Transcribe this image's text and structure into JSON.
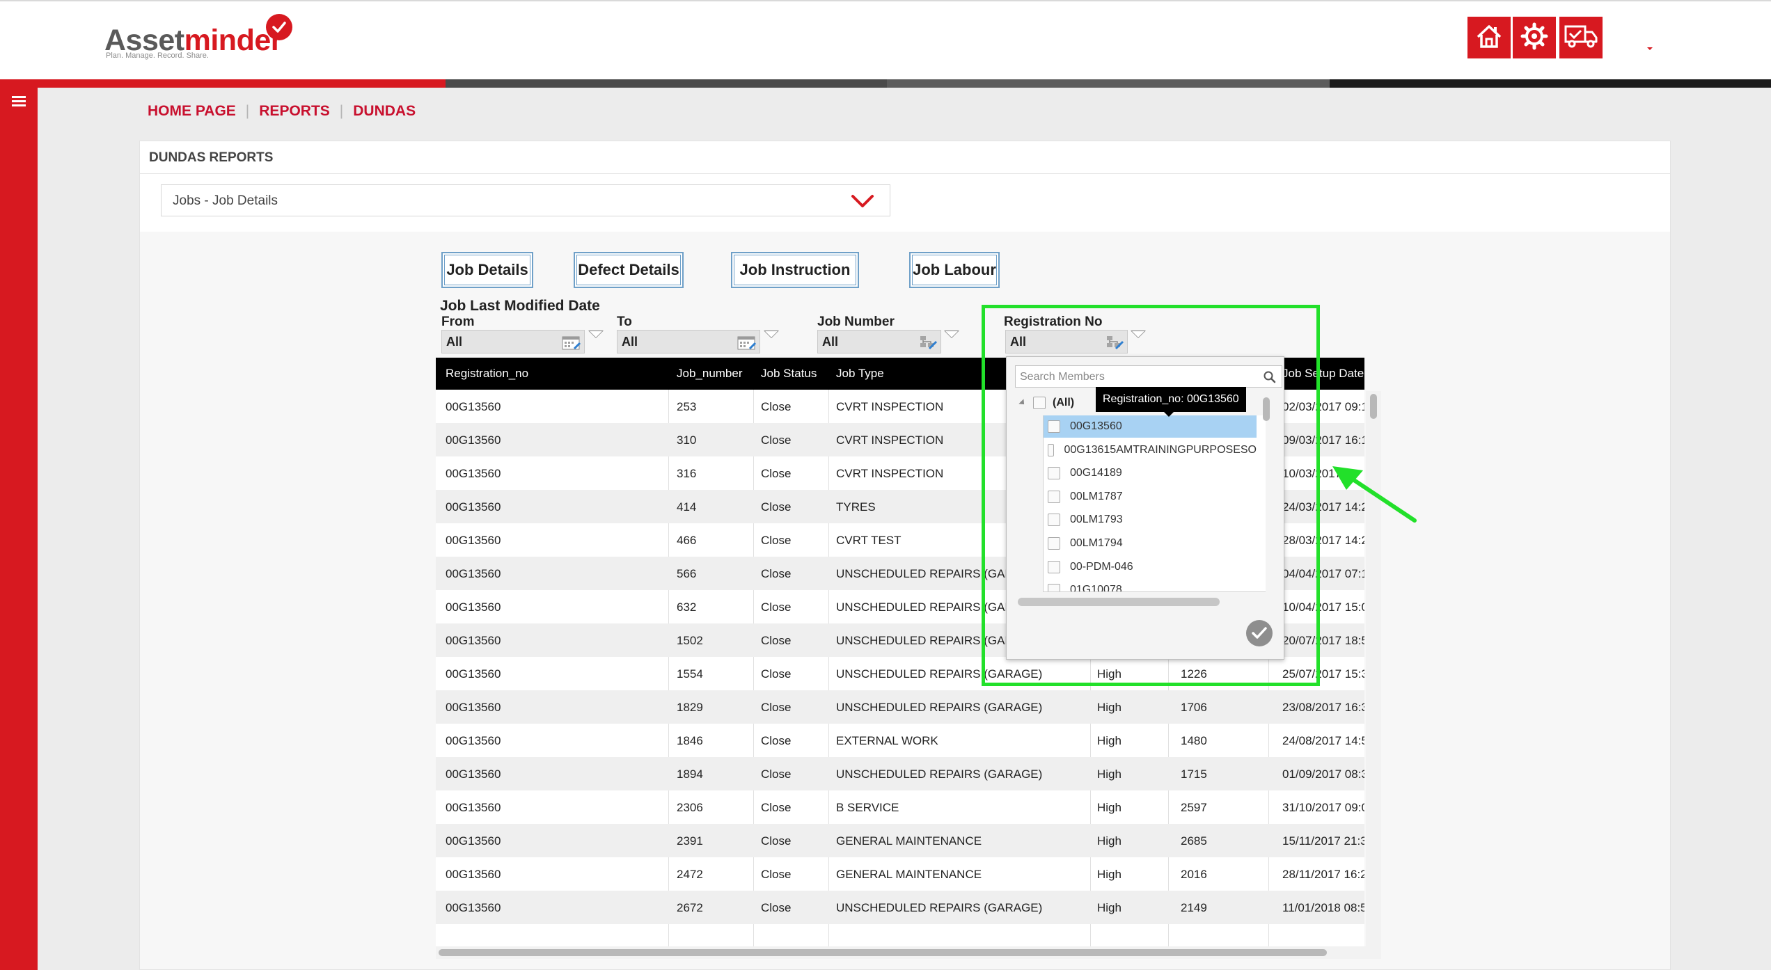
{
  "header": {
    "logo": {
      "word_part1": "Asset",
      "word_part2": "minder",
      "tagline": "Plan. Manage. Record. Share."
    },
    "buttons": [
      {
        "icon": "home-icon"
      },
      {
        "icon": "settings-gear-icon"
      },
      {
        "icon": "truck-icon"
      }
    ],
    "colors": {
      "brand_red": "#d71920",
      "progress_dark": "#4a4a4a",
      "progress_black": "#1c1c1c"
    }
  },
  "breadcrumb": {
    "items": [
      "HOME PAGE",
      "REPORTS",
      "DUNDAS"
    ],
    "separator": "|"
  },
  "panel": {
    "title": "DUNDAS REPORTS",
    "report_select": {
      "value": "Jobs - Job Details"
    }
  },
  "report": {
    "tabs": [
      "Job Details",
      "Defect Details",
      "Job Instruction",
      "Job Labour"
    ],
    "filters": {
      "group_label": "Job Last Modified Date",
      "from": {
        "label": "From",
        "value": "All"
      },
      "to": {
        "label": "To",
        "value": "All"
      },
      "job_number": {
        "label": "Job Number",
        "value": "All"
      },
      "registration_no": {
        "label": "Registration No",
        "value": "All"
      }
    },
    "table": {
      "columns": [
        "Registration_no",
        "Job_number",
        "Job Status",
        "Job Type",
        "Job Setup Date"
      ],
      "rows": [
        {
          "reg": "00G13560",
          "num": "253",
          "status": "Close",
          "type": "CVRT INSPECTION",
          "priority": "",
          "ref": "",
          "date": "02/03/2017 09:1"
        },
        {
          "reg": "00G13560",
          "num": "310",
          "status": "Close",
          "type": "CVRT INSPECTION",
          "priority": "",
          "ref": "",
          "date": "09/03/2017 16:1"
        },
        {
          "reg": "00G13560",
          "num": "316",
          "status": "Close",
          "type": "CVRT INSPECTION",
          "priority": "",
          "ref": "",
          "date": "10/03/2017"
        },
        {
          "reg": "00G13560",
          "num": "414",
          "status": "Close",
          "type": "TYRES",
          "priority": "",
          "ref": "",
          "date": "24/03/2017 14:2"
        },
        {
          "reg": "00G13560",
          "num": "466",
          "status": "Close",
          "type": "CVRT TEST",
          "priority": "",
          "ref": "",
          "date": "28/03/2017 14:2"
        },
        {
          "reg": "00G13560",
          "num": "566",
          "status": "Close",
          "type": "UNSCHEDULED REPAIRS (GARA",
          "priority": "",
          "ref": "",
          "date": "04/04/2017 07:1"
        },
        {
          "reg": "00G13560",
          "num": "632",
          "status": "Close",
          "type": "UNSCHEDULED REPAIRS (GARA",
          "priority": "",
          "ref": "",
          "date": "10/04/2017 15:0"
        },
        {
          "reg": "00G13560",
          "num": "1502",
          "status": "Close",
          "type": "UNSCHEDULED REPAIRS (GARA",
          "priority": "",
          "ref": "",
          "date": "20/07/2017 18:5"
        },
        {
          "reg": "00G13560",
          "num": "1554",
          "status": "Close",
          "type": "UNSCHEDULED REPAIRS (GARAGE)",
          "priority": "High",
          "ref": "1226",
          "date": "25/07/2017 15:3"
        },
        {
          "reg": "00G13560",
          "num": "1829",
          "status": "Close",
          "type": "UNSCHEDULED REPAIRS (GARAGE)",
          "priority": "High",
          "ref": "1706",
          "date": "23/08/2017 16:3"
        },
        {
          "reg": "00G13560",
          "num": "1846",
          "status": "Close",
          "type": "EXTERNAL WORK",
          "priority": "High",
          "ref": "1480",
          "date": "24/08/2017 14:5"
        },
        {
          "reg": "00G13560",
          "num": "1894",
          "status": "Close",
          "type": "UNSCHEDULED REPAIRS (GARAGE)",
          "priority": "High",
          "ref": "1715",
          "date": "01/09/2017 08:3"
        },
        {
          "reg": "00G13560",
          "num": "2306",
          "status": "Close",
          "type": "B SERVICE",
          "priority": "High",
          "ref": "2597",
          "date": "31/10/2017 09:0"
        },
        {
          "reg": "00G13560",
          "num": "2391",
          "status": "Close",
          "type": "GENERAL MAINTENANCE",
          "priority": "High",
          "ref": "2685",
          "date": "15/11/2017 21:3"
        },
        {
          "reg": "00G13560",
          "num": "2472",
          "status": "Close",
          "type": "GENERAL MAINTENANCE",
          "priority": "High",
          "ref": "2016",
          "date": "28/11/2017 16:2"
        },
        {
          "reg": "00G13560",
          "num": "2672",
          "status": "Close",
          "type": "UNSCHEDULED REPAIRS (GARAGE)",
          "priority": "High",
          "ref": "2149",
          "date": "11/01/2018 08:5"
        }
      ]
    },
    "member_popup": {
      "search_placeholder": "Search Members",
      "all_label": "(All)",
      "tooltip": "Registration_no: 00G13560",
      "items": [
        {
          "label": "00G13560",
          "selected": true
        },
        {
          "label": "00G13615AMTRAININGPURPOSESO",
          "selected": false
        },
        {
          "label": "00G14189",
          "selected": false
        },
        {
          "label": "00LM1787",
          "selected": false
        },
        {
          "label": "00LM1793",
          "selected": false
        },
        {
          "label": "00LM1794",
          "selected": false
        },
        {
          "label": "00-PDM-046",
          "selected": false
        },
        {
          "label": "01G10078",
          "selected": false
        }
      ]
    }
  },
  "annotation": {
    "color": "#22e02a"
  }
}
